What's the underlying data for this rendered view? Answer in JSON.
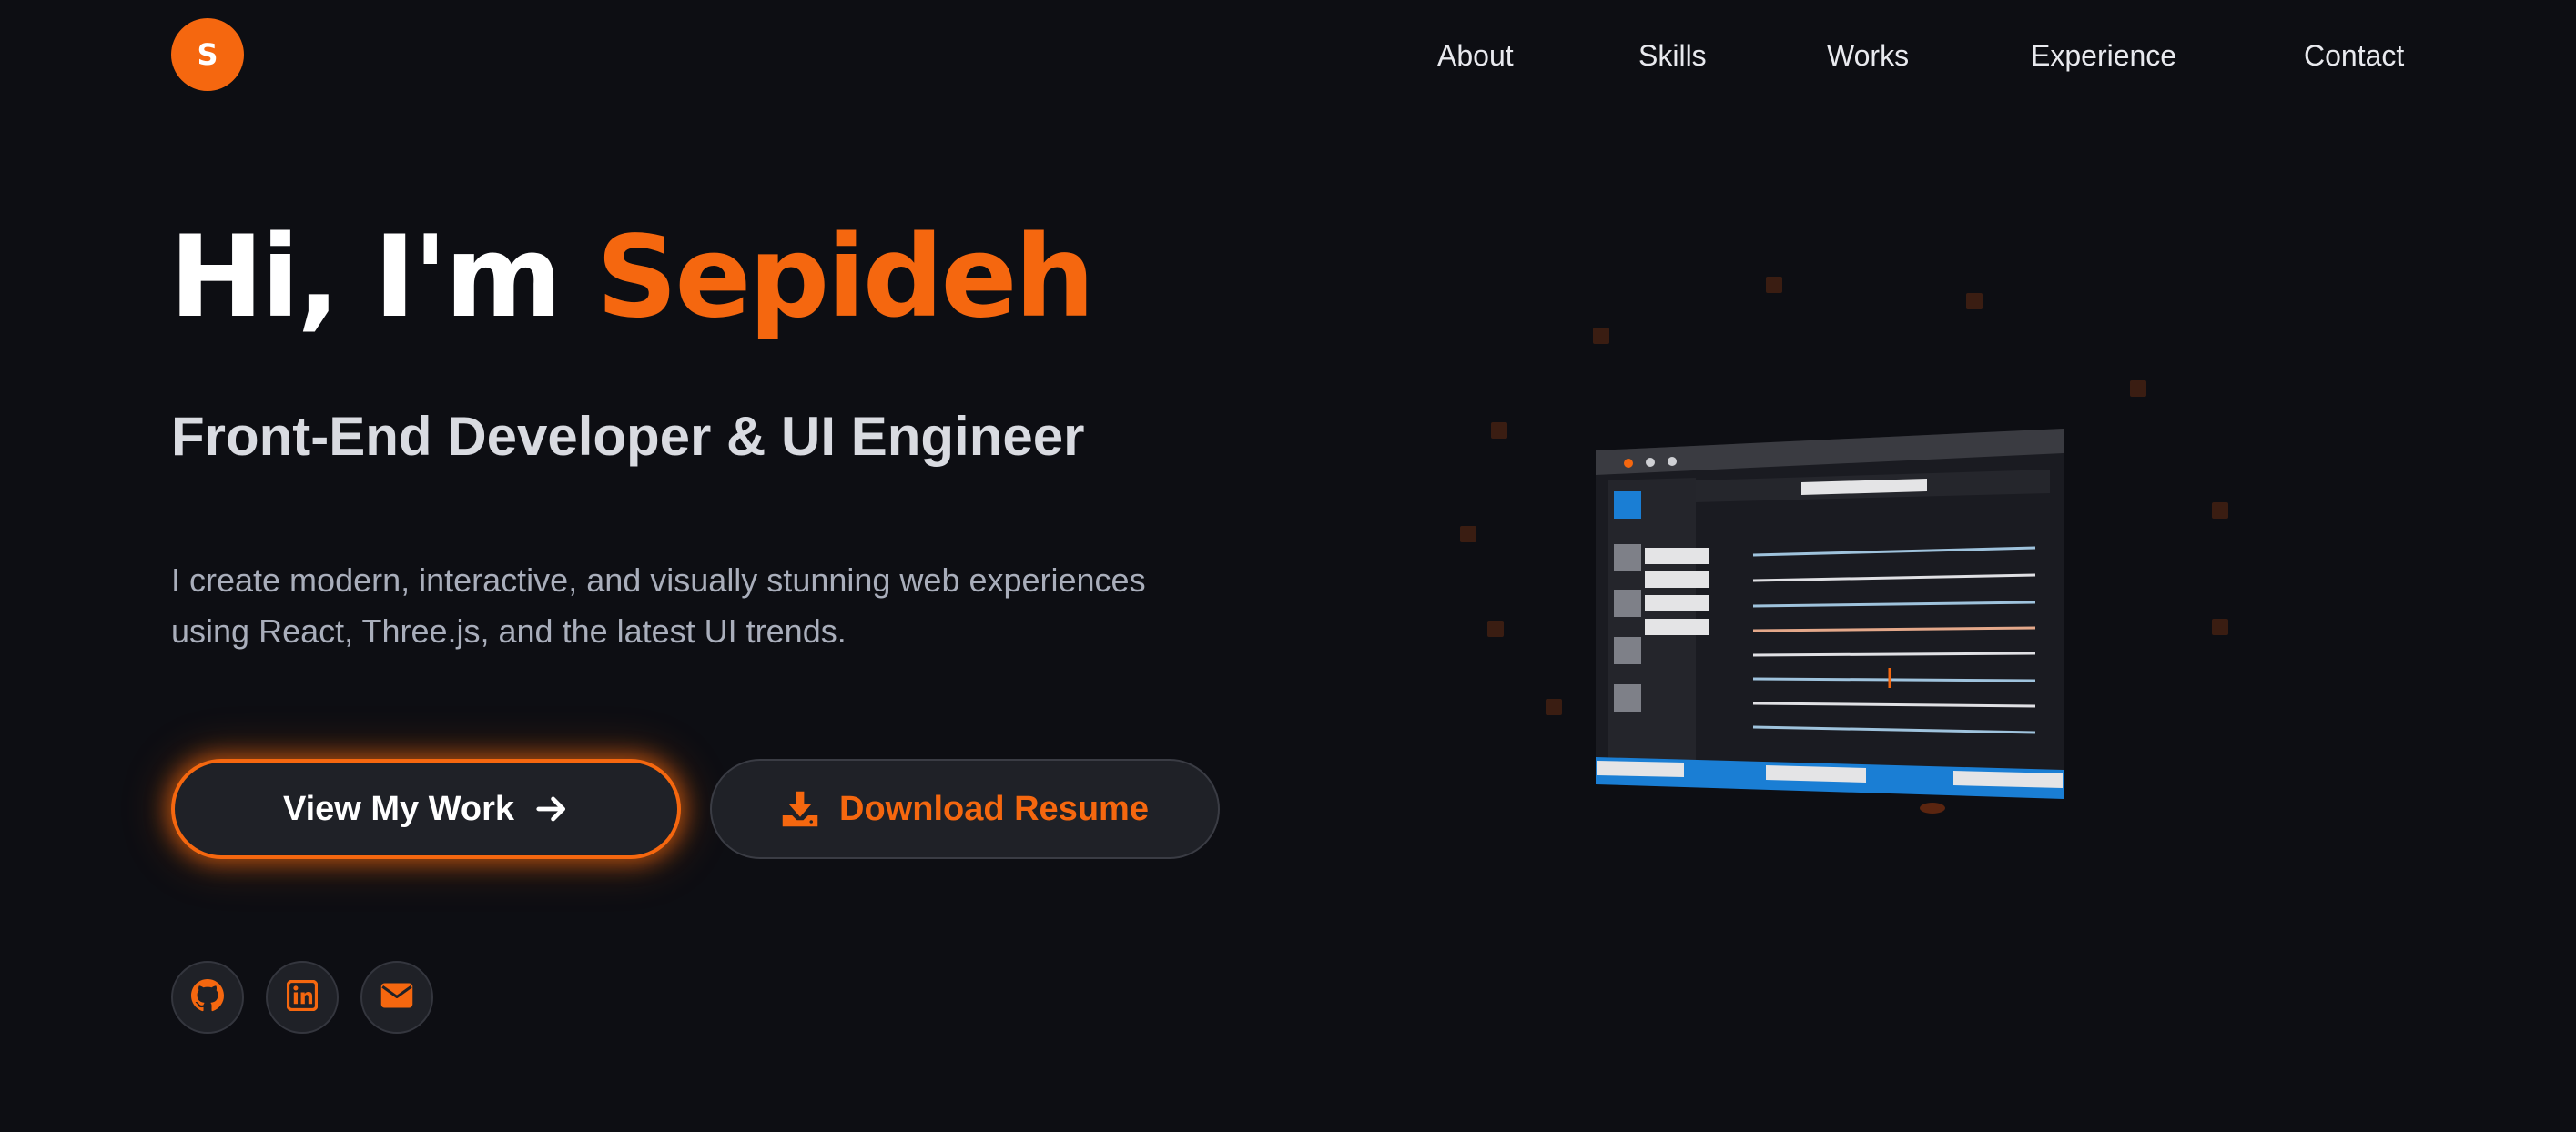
{
  "nav": {
    "logo_letter": "S",
    "items": [
      {
        "label": "About"
      },
      {
        "label": "Skills"
      },
      {
        "label": "Works"
      },
      {
        "label": "Experience"
      },
      {
        "label": "Contact"
      }
    ]
  },
  "hero": {
    "greeting": "Hi, I'm",
    "name": "Sepideh",
    "subtitle": "Front-End Developer & UI Engineer",
    "description": "I create modern, interactive, and visually stunning web experiences using React, Three.js, and the latest UI trends."
  },
  "buttons": {
    "view_work": {
      "label": "View My Work",
      "icon": "arrow-right-icon"
    },
    "download_resume": {
      "label": "Download Resume",
      "icon": "download-icon"
    }
  },
  "socials": [
    {
      "icon": "github-icon"
    },
    {
      "icon": "linkedin-icon"
    },
    {
      "icon": "mail-icon"
    }
  ],
  "colors": {
    "accent": "#f5670f",
    "background": "#0d0e13",
    "button_bg": "#1f2127",
    "editor_blue": "#1a7ed4"
  }
}
